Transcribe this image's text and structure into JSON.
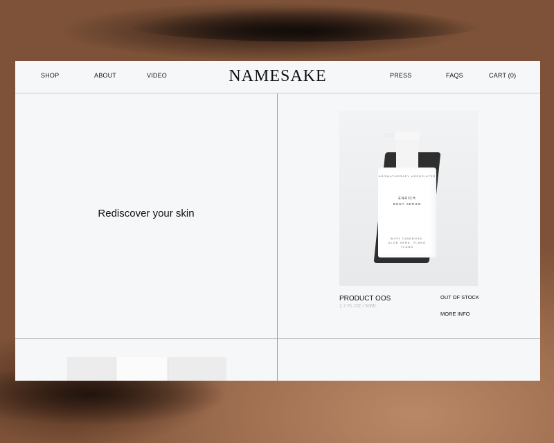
{
  "nav": {
    "left": [
      "SHOP",
      "ABOUT",
      "VIDEO"
    ],
    "logo": "NAMESAKE",
    "right": [
      "PRESS",
      "FAQS",
      "CART (0)"
    ]
  },
  "hero": {
    "text": "Rediscover your skin"
  },
  "product": {
    "name": "PRODUCT OOS",
    "size": "1.7 FL OZ / 50ML",
    "stock_status": "OUT OF STOCK",
    "more_info": "MORE INFO",
    "bottle_labels": {
      "brand": "AROMATHERAPY ASSOCIATES",
      "title": "ENRICH",
      "subtitle": "BODY SERUM",
      "notes": "WITH TUBEROSE, ALOE VERA, YLANG YLANG"
    }
  }
}
